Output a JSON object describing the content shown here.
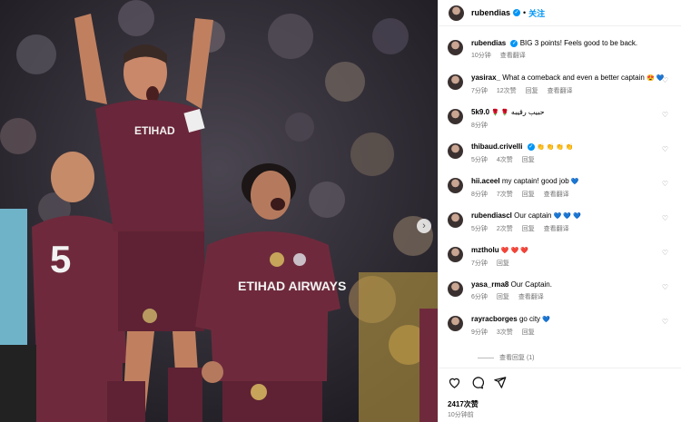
{
  "post": {
    "username": "rubendias",
    "follow_label": "关注",
    "likes": "2417次赞",
    "time_ago": "10分钟前"
  },
  "caption": {
    "username": "rubendias",
    "text": "BIG 3 points! Feels good to be back.",
    "time": "10分钟",
    "translate": "查看翻译"
  },
  "comments": [
    {
      "username": "yasirax_",
      "text": "What a comeback and even a better captain",
      "emoji": "😍 💙",
      "time": "7分钟",
      "likes": "12次赞",
      "reply": "回复",
      "translate": "查看翻译"
    },
    {
      "username": "5k9.0",
      "text": "حبيب رقيبه",
      "emoji": "🌹 🌹",
      "time": "8分钟",
      "likes": "",
      "reply": "",
      "translate": ""
    },
    {
      "username": "thibaud.crivelli",
      "text": "",
      "emoji": "👏 👏 👏 👏",
      "time": "5分钟",
      "likes": "4次赞",
      "reply": "回复",
      "translate": "",
      "verified": true
    },
    {
      "username": "hii.aceel",
      "text": "my captain! good job",
      "emoji": "💙",
      "time": "8分钟",
      "likes": "7次赞",
      "reply": "回复",
      "translate": "查看翻译"
    },
    {
      "username": "rubendiascl",
      "text": "Our captain",
      "emoji": "💙 💙 💙",
      "time": "5分钟",
      "likes": "2次赞",
      "reply": "回复",
      "translate": "查看翻译"
    },
    {
      "username": "mztholu",
      "text": "",
      "emoji": "❤️ ❤️ ❤️",
      "time": "7分钟",
      "likes": "",
      "reply": "回复",
      "translate": ""
    },
    {
      "username": "yasa_rma8",
      "text": "Our Captain.",
      "emoji": "",
      "time": "6分钟",
      "likes": "",
      "reply": "回复",
      "translate": "查看翻译"
    },
    {
      "username": "rayracborges",
      "text": "go city",
      "emoji": "💙",
      "time": "9分钟",
      "likes": "3次赞",
      "reply": "回复",
      "translate": ""
    }
  ],
  "view_replies": "查看回复 (1)",
  "photo": {
    "kit_sponsor": "ETIHAD AIRWAYS",
    "shirt_number": "5"
  }
}
